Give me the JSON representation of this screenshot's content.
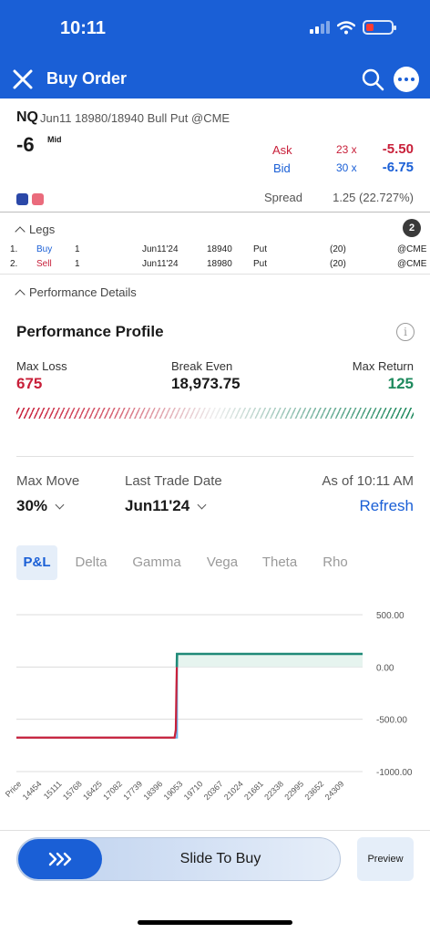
{
  "status": {
    "time": "10:11"
  },
  "header": {
    "title": "Buy Order",
    "close_icon": "close-icon",
    "search_icon": "search-icon",
    "more_icon": "more-icon"
  },
  "quote": {
    "symbol": "NQ",
    "description": "Jun11 18980/18940 Bull Put @CME",
    "quantity": "-6",
    "price_type": "Mid",
    "ask_label": "Ask",
    "ask_size": "23 x",
    "ask_price": "-5.50",
    "bid_label": "Bid",
    "bid_size": "30 x",
    "bid_price": "-6.75",
    "spread_label": "Spread",
    "spread_value": "1.25 (22.727%)",
    "colors": {
      "ask": "#c8203a",
      "bid": "#1a5fd6"
    }
  },
  "legs": {
    "title": "Legs",
    "count": "2",
    "rows": [
      {
        "num": "1.",
        "side": "Buy",
        "qty": "1",
        "expiry": "Jun11'24",
        "strike": "18940",
        "type": "Put",
        "mult": "(20)",
        "exchange": "@CME"
      },
      {
        "num": "2.",
        "side": "Sell",
        "qty": "1",
        "expiry": "Jun11'24",
        "strike": "18980",
        "type": "Put",
        "mult": "(20)",
        "exchange": "@CME"
      }
    ]
  },
  "performance_details": {
    "title": "Performance Details"
  },
  "profile": {
    "title": "Performance Profile",
    "info_icon": "info-icon",
    "max_loss_label": "Max Loss",
    "max_loss": "675",
    "break_even_label": "Break Even",
    "break_even": "18,973.75",
    "max_return_label": "Max Return",
    "max_return": "125",
    "colors": {
      "loss": "#c8203a",
      "gain": "#1f8a5e"
    }
  },
  "controls": {
    "max_move_label": "Max Move",
    "max_move": "30%",
    "last_trade_label": "Last Trade Date",
    "last_trade": "Jun11'24",
    "as_of": "As of 10:11 AM",
    "refresh": "Refresh"
  },
  "tabs": [
    {
      "label": "P&L",
      "active": true
    },
    {
      "label": "Delta"
    },
    {
      "label": "Gamma"
    },
    {
      "label": "Vega"
    },
    {
      "label": "Theta"
    },
    {
      "label": "Rho"
    }
  ],
  "chart_data": {
    "type": "line",
    "y_ticks": [
      "500.00",
      "0.00",
      "-500.00",
      "-1000.00"
    ],
    "ylim": [
      -1000,
      500
    ],
    "x_ticks": [
      "Price",
      "14454",
      "15111",
      "15768",
      "16425",
      "17082",
      "17739",
      "18396",
      "19053",
      "19710",
      "20367",
      "21024",
      "21681",
      "22338",
      "22995",
      "23652",
      "24309"
    ],
    "series": [
      {
        "values_x": [
          13797,
          18900,
          18940,
          18960,
          18980,
          19050,
          24966
        ],
        "values_y": [
          -675,
          -675,
          -600,
          -200,
          125,
          125,
          125
        ],
        "color": "#c8203a",
        "color_after_zero": "#1f8a78"
      },
      {
        "values_x": [
          13797,
          18940,
          18940,
          18980,
          18980,
          24966
        ],
        "values_y": [
          -675,
          -675,
          -675,
          -675,
          125,
          125
        ],
        "color": "#6aaee8"
      }
    ],
    "grid": true
  },
  "bottom": {
    "slide_label": "Slide To Buy",
    "preview": "Preview",
    "knob_icon": "chevrons-right-icon"
  }
}
